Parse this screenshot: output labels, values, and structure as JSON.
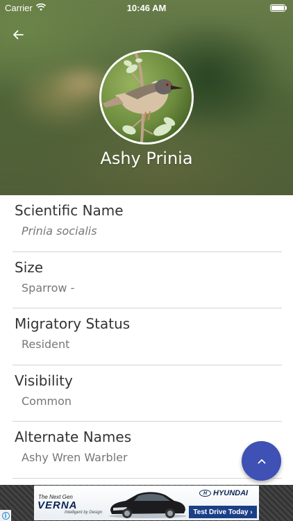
{
  "status_bar": {
    "carrier": "Carrier",
    "time": "10:46 AM",
    "battery_level": 1.0
  },
  "header": {
    "back_icon": "arrow-left-icon",
    "title": "Ashy Prinia"
  },
  "details": [
    {
      "label": "Scientific Name",
      "value": "Prinia socialis"
    },
    {
      "label": "Size",
      "value": "Sparrow -"
    },
    {
      "label": "Migratory Status",
      "value": "Resident"
    },
    {
      "label": "Visibility",
      "value": "Common"
    },
    {
      "label": "Alternate Names",
      "value": "Ashy Wren Warbler"
    }
  ],
  "fab": {
    "icon": "chevron-up-icon",
    "color": "#3f51b5"
  },
  "ad": {
    "tagline": "The Next Gen",
    "model": "VERNA",
    "slogan": "Intelligent by Design",
    "brand": "HYUNDAI",
    "cta": "Test Drive Today ›",
    "info_icon": "i"
  }
}
